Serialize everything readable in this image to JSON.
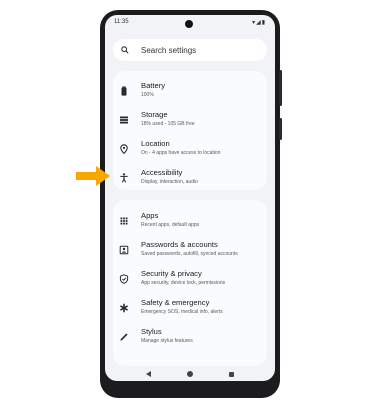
{
  "status_bar": {
    "time": "11:35",
    "icons": "▾◢▮"
  },
  "search": {
    "placeholder": "Search settings",
    "icon": "search-icon"
  },
  "groups": [
    {
      "items": [
        {
          "title": "Battery",
          "subtitle": "100%",
          "icon": "battery-icon"
        },
        {
          "title": "Storage",
          "subtitle": "18% used - 105 GB free",
          "icon": "storage-icon"
        },
        {
          "title": "Location",
          "subtitle": "On - 4 apps have access to location",
          "icon": "location-icon"
        },
        {
          "title": "Accessibility",
          "subtitle": "Display, interaction, audio",
          "icon": "accessibility-icon"
        }
      ]
    },
    {
      "items": [
        {
          "title": "Apps",
          "subtitle": "Recent apps, default apps",
          "icon": "apps-icon"
        },
        {
          "title": "Passwords & accounts",
          "subtitle": "Saved passwords, autofill, synced accounts",
          "icon": "passwords-icon"
        },
        {
          "title": "Security & privacy",
          "subtitle": "App security, device lock, permissions",
          "icon": "shield-icon"
        },
        {
          "title": "Safety & emergency",
          "subtitle": "Emergency SOS, medical info, alerts",
          "icon": "emergency-icon"
        },
        {
          "title": "Stylus",
          "subtitle": "Manage stylus features",
          "icon": "stylus-icon"
        }
      ]
    }
  ],
  "colors": {
    "accent_arrow": "#f5a800",
    "card_bg": "#fafbfd",
    "screen_bg": "#f2f3f6",
    "phone_frame": "#1c1c1e"
  }
}
